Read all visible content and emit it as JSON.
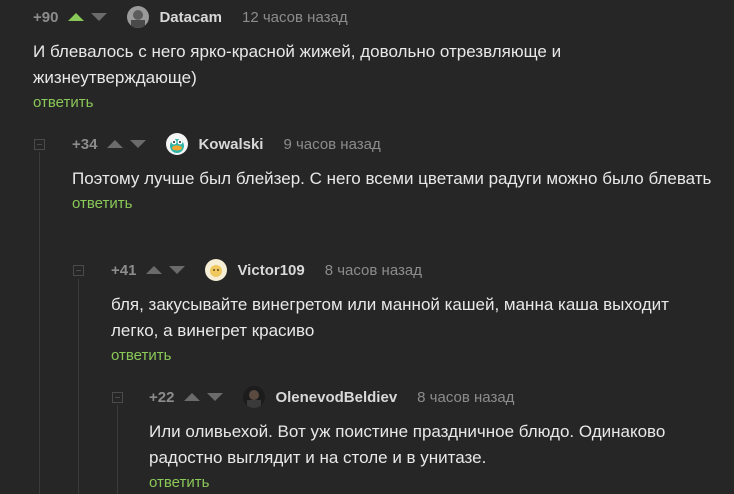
{
  "comments": [
    {
      "rating": "+90",
      "username": "Datacam",
      "time": "12 часов назад",
      "text": "И блевалось с него ярко-красной жижей, довольно отрезвляюще и жизнеутверждающе)",
      "reply_label": "ответить"
    },
    {
      "rating": "+34",
      "username": "Kowalski",
      "time": "9 часов назад",
      "text": "Поэтому лучше был блейзер. С него всеми цветами радуги можно было блевать",
      "reply_label": "ответить"
    },
    {
      "rating": "+41",
      "username": "Victor109",
      "time": "8 часов назад",
      "text": "бля, закусывайте винегретом или манной кашей, манна каша выходит легко, а винегрет красиво",
      "reply_label": "ответить"
    },
    {
      "rating": "+22",
      "username": "OlenevodBeldiev",
      "time": "8 часов назад",
      "text": "Или оливьехой. Вот уж поистине праздничное блюдо. Одинаково радостно выглядит и на столе и в унитазе.",
      "reply_label": "ответить"
    }
  ],
  "colors": {
    "background": "#262626",
    "reply": "#8ac858",
    "upvote_active": "#8ac858"
  },
  "icons": {
    "upvote": "triangle-up-icon",
    "downvote": "triangle-down-icon",
    "collapse": "minus-box-icon"
  }
}
